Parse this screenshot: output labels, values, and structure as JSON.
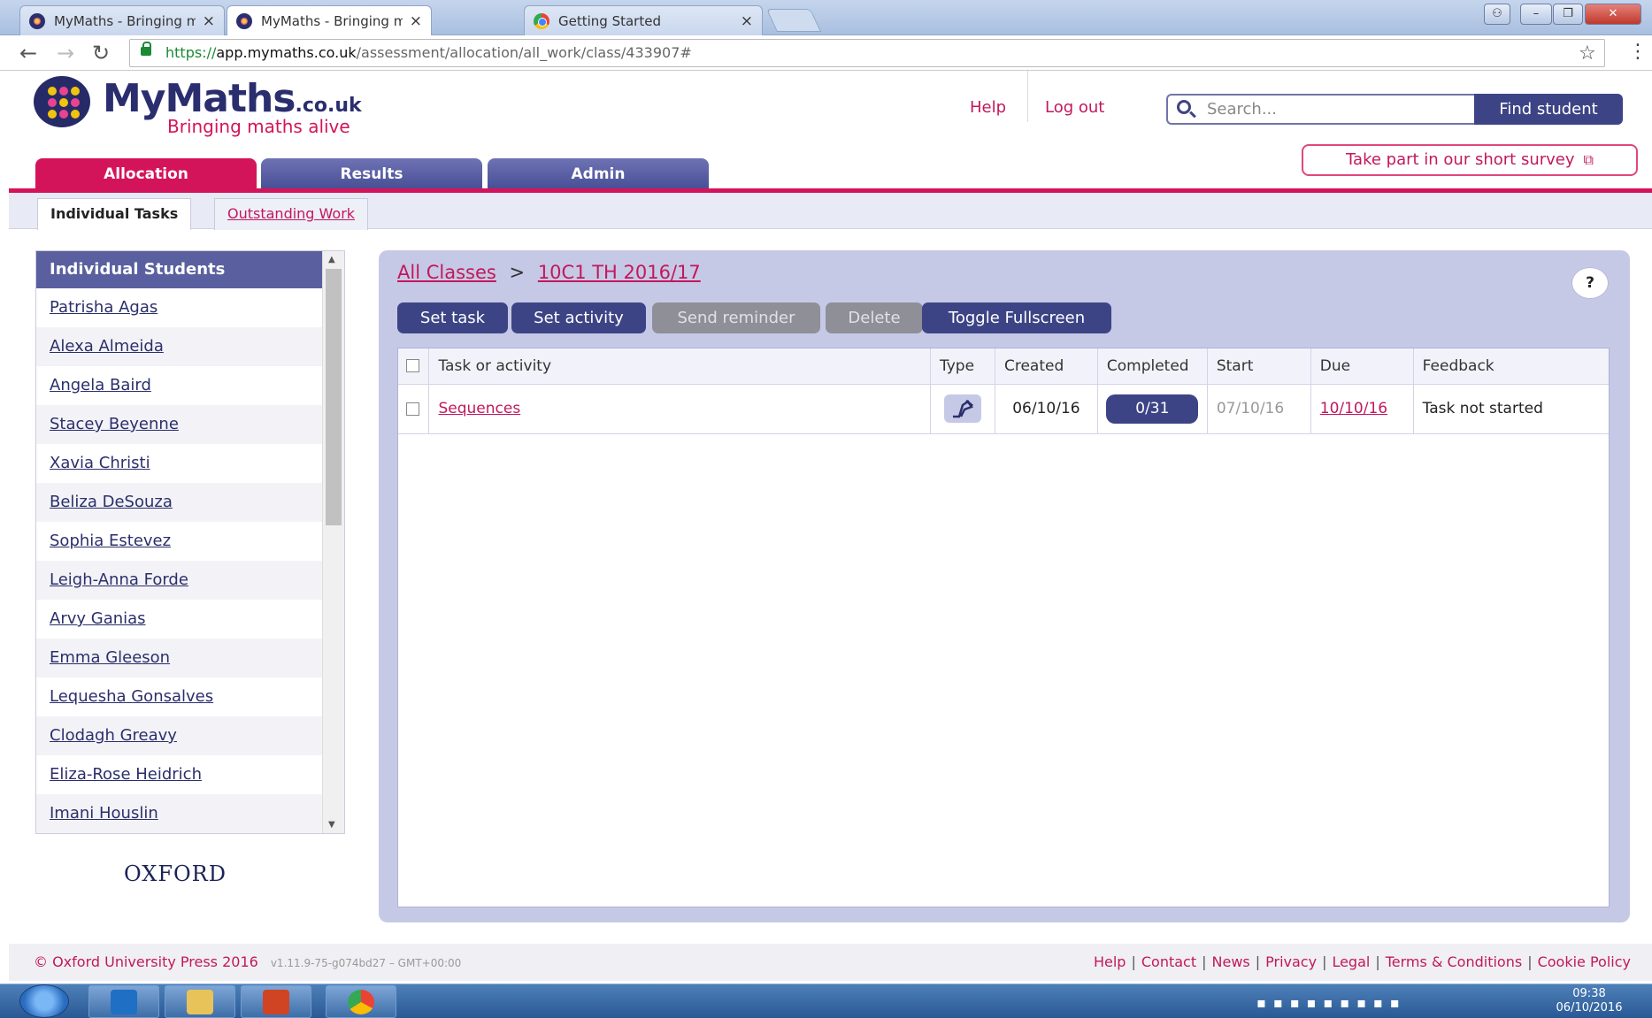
{
  "browser": {
    "tabs": [
      {
        "title": "MyMaths - Bringing mat",
        "icon": "mymaths-favicon-icon"
      },
      {
        "title": "MyMaths - Bringing mat",
        "icon": "mymaths-favicon-icon"
      },
      {
        "title": "Getting Started",
        "icon": "chrome-favicon-icon"
      }
    ],
    "close_glyph": "×",
    "url_scheme": "https://",
    "url_host": "app.mymaths.co.uk",
    "url_path": "/assessment/allocation/all_work/class/433907#"
  },
  "header": {
    "logo_main": "MyMaths",
    "logo_domain": ".co.uk",
    "tagline": "Bringing maths alive",
    "help": "Help",
    "logout": "Log out",
    "search_placeholder": "Search...",
    "find_student": "Find student",
    "survey": "Take part in our short survey"
  },
  "main_tabs": [
    "Allocation",
    "Results",
    "Admin"
  ],
  "sub_tabs": [
    "Individual Tasks",
    "Outstanding Work"
  ],
  "sidebar": {
    "title": "Individual Students",
    "students": [
      "Patrisha Agas",
      "Alexa Almeida",
      "Angela Baird",
      "Stacey Beyenne",
      "Xavia Christi",
      "Beliza DeSouza",
      "Sophia Estevez",
      "Leigh-Anna Forde",
      "Arvy Ganias",
      "Emma Gleeson",
      "Lequesha Gonsalves",
      "Clodagh Greavy",
      "Eliza-Rose Heidrich",
      "Imani Houslin"
    ],
    "publisher": "OXFORD"
  },
  "breadcrumb": {
    "root": "All Classes",
    "separator": ">",
    "current": "10C1 TH 2016/17"
  },
  "help_button": "?",
  "actions": [
    {
      "label": "Set task",
      "enabled": true
    },
    {
      "label": "Set activity",
      "enabled": true
    },
    {
      "label": "Send reminder",
      "enabled": false
    },
    {
      "label": "Delete",
      "enabled": false
    },
    {
      "label": "Toggle Fullscreen",
      "enabled": true
    }
  ],
  "table": {
    "columns": [
      "Task or activity",
      "Type",
      "Created",
      "Completed",
      "Start",
      "Due",
      "Feedback"
    ],
    "rows": [
      {
        "task": "Sequences",
        "type_icon": "homework-task-icon",
        "created": "06/10/16",
        "completed": "0/31",
        "start": "07/10/16",
        "due": "10/10/16",
        "feedback": "Task not started"
      }
    ]
  },
  "footer": {
    "copyright": "© Oxford University Press 2016",
    "version": "v1.11.9-75-g074bd27 – GMT+00:00",
    "links": [
      "Help",
      "Contact",
      "News",
      "Privacy",
      "Legal",
      "Terms & Conditions",
      "Cookie Policy"
    ]
  },
  "taskbar": {
    "time": "09:38",
    "date": "06/10/2016",
    "apps": [
      "outlook-icon",
      "explorer-folder-icon",
      "powerpoint-icon",
      "chrome-icon"
    ]
  },
  "colors": {
    "brand_pink": "#d4145a",
    "brand_navy": "#3d4486",
    "panel_lavender": "#c6c9e6"
  }
}
